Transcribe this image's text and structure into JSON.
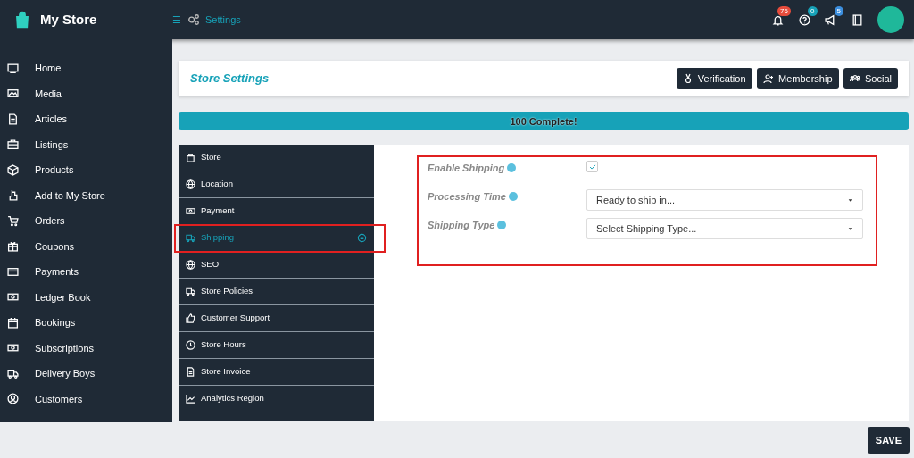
{
  "brand": {
    "title": "My Store"
  },
  "topbar": {
    "menu_glyph": "☰",
    "breadcrumb": "Settings",
    "notifications": [
      {
        "count": "76",
        "color": "#e74c3c"
      },
      {
        "count": "0",
        "color": "#17a2b8"
      },
      {
        "count": "5",
        "color": "#3b8ede"
      }
    ]
  },
  "sidebar": {
    "items": [
      {
        "label": "Home"
      },
      {
        "label": "Media"
      },
      {
        "label": "Articles"
      },
      {
        "label": "Listings"
      },
      {
        "label": "Products"
      },
      {
        "label": "Add to My Store"
      },
      {
        "label": "Orders"
      },
      {
        "label": "Coupons"
      },
      {
        "label": "Payments"
      },
      {
        "label": "Ledger Book"
      },
      {
        "label": "Bookings"
      },
      {
        "label": "Subscriptions"
      },
      {
        "label": "Delivery Boys"
      },
      {
        "label": "Customers"
      }
    ]
  },
  "header": {
    "title": "Store Settings",
    "buttons": [
      {
        "label": "Verification"
      },
      {
        "label": "Membership"
      },
      {
        "label": "Social"
      }
    ]
  },
  "progress": {
    "label": "100 Complete!",
    "level": 1
  },
  "settings_menu": {
    "items": [
      {
        "label": "Store",
        "selected": false,
        "highlighted": false
      },
      {
        "label": "Location",
        "selected": false,
        "highlighted": false
      },
      {
        "label": "Payment",
        "selected": false,
        "highlighted": false
      },
      {
        "label": "Shipping",
        "selected": true,
        "highlighted": true
      },
      {
        "label": "SEO",
        "selected": false,
        "highlighted": false
      },
      {
        "label": "Store Policies",
        "selected": false,
        "highlighted": false
      },
      {
        "label": "Customer Support",
        "selected": false,
        "highlighted": false
      },
      {
        "label": "Store Hours",
        "selected": false,
        "highlighted": false
      },
      {
        "label": "Store Invoice",
        "selected": false,
        "highlighted": false
      },
      {
        "label": "Analytics Region",
        "selected": false,
        "highlighted": false
      }
    ]
  },
  "form": {
    "highlighted": true,
    "fields": [
      {
        "kind": "checkbox",
        "label": "Enable Shipping",
        "checked": true
      },
      {
        "kind": "select",
        "label": "Processing Time",
        "value": "Ready to ship in..."
      },
      {
        "kind": "select",
        "label": "Shipping Type",
        "value": "Select Shipping Type..."
      }
    ]
  },
  "footer": {
    "save": "SAVE"
  }
}
